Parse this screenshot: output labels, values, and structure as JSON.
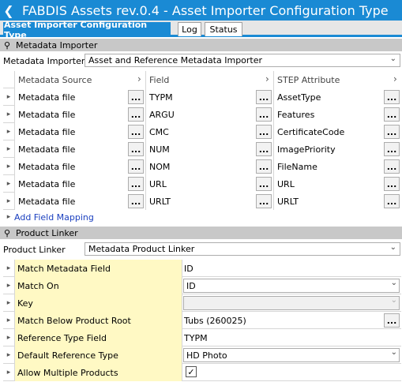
{
  "window": {
    "title": "FABDIS Assets rev.0.4 - Asset Importer Configuration Type"
  },
  "tabs": [
    {
      "label": "Asset Importer Configuration Type"
    },
    {
      "label": "Log"
    },
    {
      "label": "Status"
    }
  ],
  "metadata_importer": {
    "section_label": "Metadata Importer",
    "field_label": "Metadata Importer",
    "selected_value": "Asset and Reference Metadata Importer",
    "columns": [
      "Metadata Source",
      "Field",
      "STEP Attribute"
    ],
    "rows": [
      {
        "source": "Metadata file",
        "field": "TYPM",
        "attribute": "AssetType"
      },
      {
        "source": "Metadata file",
        "field": "ARGU",
        "attribute": "Features"
      },
      {
        "source": "Metadata file",
        "field": "CMC",
        "attribute": "CertificateCode"
      },
      {
        "source": "Metadata file",
        "field": "NUM",
        "attribute": "ImagePriority"
      },
      {
        "source": "Metadata file",
        "field": "NOM",
        "attribute": "FileName"
      },
      {
        "source": "Metadata file",
        "field": "URL",
        "attribute": "URL"
      },
      {
        "source": "Metadata file",
        "field": "URLT",
        "attribute": "URLT"
      }
    ],
    "ellipsis_label": "...",
    "add_mapping_label": "Add Field Mapping"
  },
  "product_linker": {
    "section_label": "Product Linker",
    "field_label": "Product Linker",
    "selected_value": "Metadata Product Linker",
    "properties": [
      {
        "name": "Match Metadata Field",
        "value": "ID"
      },
      {
        "name": "Match On",
        "value": "ID"
      },
      {
        "name": "Key",
        "value": ""
      },
      {
        "name": "Match Below Product Root",
        "value": "Tubs (260025)"
      },
      {
        "name": "Reference Type Field",
        "value": "TYPM"
      },
      {
        "name": "Default Reference Type",
        "value": "HD Photo"
      },
      {
        "name": "Allow Multiple Products",
        "value": "checked"
      }
    ]
  },
  "colors": {
    "accent": "#1a8ad4",
    "property_name_bg": "#fff9c4",
    "link": "#1a3fbf"
  }
}
